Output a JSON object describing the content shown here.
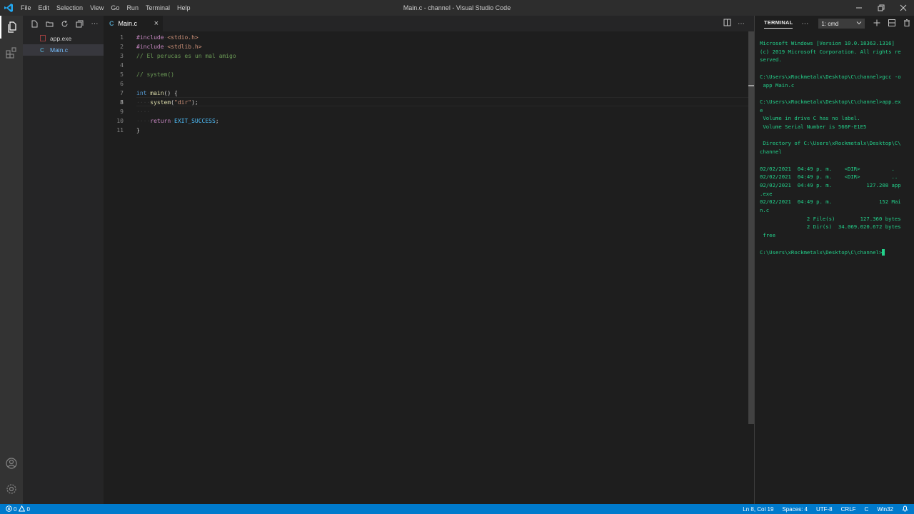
{
  "window": {
    "title": "Main.c - channel - Visual Studio Code",
    "menu": [
      "File",
      "Edit",
      "Selection",
      "View",
      "Go",
      "Run",
      "Terminal",
      "Help"
    ]
  },
  "explorer": {
    "files": [
      {
        "name": "app.exe",
        "icon": "binary-file-icon",
        "selected": false
      },
      {
        "name": "Main.c",
        "icon": "c-file-icon",
        "selected": true
      }
    ]
  },
  "editor": {
    "tab": {
      "label": "Main.c",
      "close": "×"
    },
    "line_numbers": [
      "1",
      "2",
      "3",
      "4",
      "5",
      "6",
      "7",
      "8",
      "9",
      "10",
      "11"
    ],
    "current_line": 8,
    "code": {
      "l1_pre": "#include",
      "l1_hdr": "<stdio.h>",
      "l2_pre": "#include",
      "l2_hdr": "<stdlib.h>",
      "l3": "// El perucas es un mal amigo",
      "l5": "// system()",
      "l7_kw": "int",
      "l7_fn": "main",
      "l7_rest": "() {",
      "l8_fn": "system",
      "l8_str": "\"dir\"",
      "l8_rest": ");",
      "l10_kw": "return",
      "l10_const": "EXIT_SUCCESS",
      "l10_rest": ";",
      "l11": "}"
    }
  },
  "panel": {
    "tab_label": "TERMINAL",
    "terminal_select": "1: cmd",
    "output": "Microsoft Windows [Version 10.0.18363.1316]\n(c) 2019 Microsoft Corporation. All rights re\nserved.\n\nC:\\Users\\xRockmetalx\\Desktop\\C\\channel>gcc -o\n app Main.c\n\nC:\\Users\\xRockmetalx\\Desktop\\C\\channel>app.ex\ne\n Volume in drive C has no label.\n Volume Serial Number is 566F-E1E5\n\n Directory of C:\\Users\\xRockmetalx\\Desktop\\C\\\nchannel\n\n02/02/2021  04:49 p. m.    <DIR>          .\n02/02/2021  04:49 p. m.    <DIR>          ..\n02/02/2021  04:49 p. m.           127.208 app\n.exe\n02/02/2021  04:49 p. m.               152 Mai\nn.c\n               2 File(s)        127.360 bytes\n               2 Dir(s)  34.069.020.672 bytes\n free\n\nC:\\Users\\xRockmetalx\\Desktop\\C\\channel>"
  },
  "statusbar": {
    "errors": "0",
    "warnings": "0",
    "position": "Ln 8, Col 19",
    "spaces": "Spaces: 4",
    "encoding": "UTF-8",
    "eol": "CRLF",
    "language": "C",
    "platform": "Win32"
  },
  "colors": {
    "accent": "#007acc",
    "terminal_text": "#23d18b",
    "title_bar": "#2d2d2d",
    "activity_bar": "#333333",
    "sidebar": "#252526",
    "editor_bg": "#1e1e1e"
  }
}
